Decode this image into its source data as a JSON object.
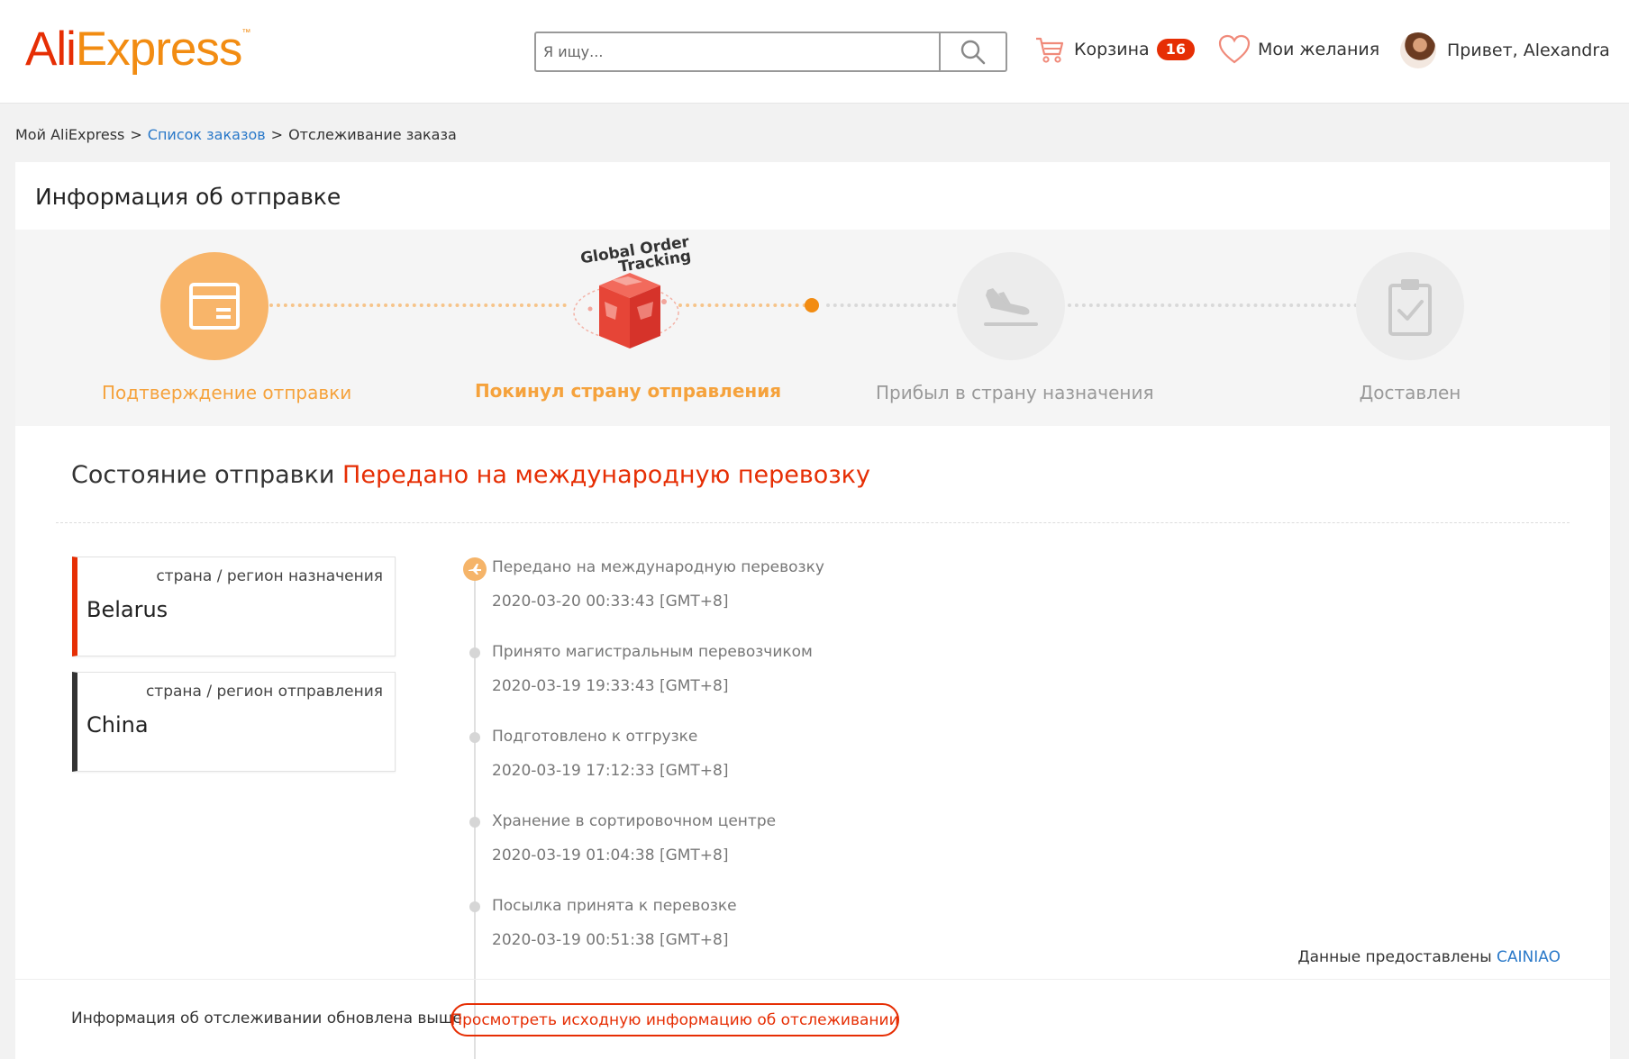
{
  "header": {
    "logo": {
      "part1": "Ali",
      "part2": "Express",
      "tm": "™"
    },
    "search": {
      "placeholder": "Я ищу..."
    },
    "cart": {
      "label": "Корзина",
      "count": "16"
    },
    "wishlist": {
      "label": "Мои желания"
    },
    "user": {
      "greeting": "Привет, Alexandra"
    }
  },
  "breadcrumb": {
    "root": "Мой AliExpress",
    "sep1": ">",
    "orders": "Список заказов",
    "sep2": ">",
    "current": "Отслеживание заказа"
  },
  "shipment": {
    "title": "Информация об отправке",
    "badge_text": {
      "line1": "Global Order",
      "line2": "Tracking"
    },
    "steps": [
      {
        "label": "Подтверждение отправки",
        "icon": "box-icon",
        "state": "done"
      },
      {
        "label": "Покинул страну отправления",
        "icon": "global-order-tracking-icon",
        "state": "current"
      },
      {
        "label": "Прибыл в страну назначения",
        "icon": "plane-landing-icon",
        "state": "pending"
      },
      {
        "label": "Доставлен",
        "icon": "clipboard-check-icon",
        "state": "pending"
      }
    ]
  },
  "status": {
    "label": "Состояние отправки",
    "value": "Передано на международную перевозку"
  },
  "regions": [
    {
      "label": "страна / регион назначения",
      "value": "Belarus",
      "accent": "#e62e04"
    },
    {
      "label": "страна / регион отправления",
      "value": "China",
      "accent": "#333333"
    }
  ],
  "timeline": [
    {
      "title": "Передано на международную перевозку",
      "time": "2020-03-20 00:33:43 [GMT+8]"
    },
    {
      "title": "Принято магистральным перевозчиком",
      "time": "2020-03-19 19:33:43 [GMT+8]"
    },
    {
      "title": "Подготовлено к отгрузке",
      "time": "2020-03-19 17:12:33 [GMT+8]"
    },
    {
      "title": "Хранение в сортировочном центре",
      "time": "2020-03-19 01:04:38 [GMT+8]"
    },
    {
      "title": "Посылка принята к перевозке",
      "time": "2020-03-19 00:51:38 [GMT+8]"
    }
  ],
  "provided": {
    "label": "Данные предоставлены",
    "provider": "CAINIAO"
  },
  "footer": {
    "note": "Информация об отслеживании обновлена выше",
    "button": "Просмотреть исходную информацию об отслеживании"
  },
  "colors": {
    "brand_red": "#e62e04",
    "brand_orange": "#f28c12",
    "link_blue": "#2a79c9"
  }
}
